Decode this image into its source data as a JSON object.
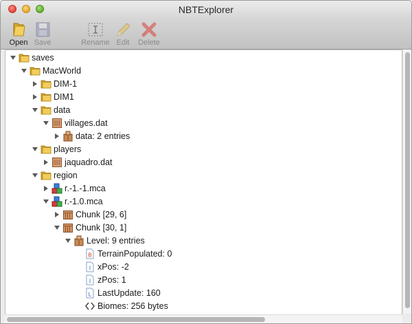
{
  "window": {
    "title": "NBTExplorer"
  },
  "toolbar": {
    "open_label": "Open",
    "save_label": "Save",
    "rename_label": "Rename",
    "edit_label": "Edit",
    "delete_label": "Delete"
  },
  "tree": {
    "rows": [
      {
        "label": "saves",
        "icon": "folder-icon",
        "expanded": true
      },
      {
        "label": "MacWorld",
        "icon": "folder-icon",
        "expanded": true
      },
      {
        "label": "DIM-1",
        "icon": "folder-icon",
        "expanded": false
      },
      {
        "label": "DIM1",
        "icon": "folder-icon",
        "expanded": false
      },
      {
        "label": "data",
        "icon": "folder-icon",
        "expanded": true
      },
      {
        "label": "villages.dat",
        "icon": "nbt-file-icon",
        "expanded": true
      },
      {
        "label": "data: 2 entries",
        "icon": "compound-tag-icon",
        "expanded": false
      },
      {
        "label": "players",
        "icon": "folder-icon",
        "expanded": true
      },
      {
        "label": "jaquadro.dat",
        "icon": "nbt-file-icon",
        "expanded": false
      },
      {
        "label": "region",
        "icon": "folder-icon",
        "expanded": true
      },
      {
        "label": "r.-1.-1.mca",
        "icon": "region-file-icon",
        "expanded": false
      },
      {
        "label": "r.-1.0.mca",
        "icon": "region-file-icon",
        "expanded": true
      },
      {
        "label": "Chunk [29, 6]",
        "icon": "chunk-icon",
        "expanded": false
      },
      {
        "label": "Chunk [30, 1]",
        "icon": "chunk-icon",
        "expanded": true
      },
      {
        "label": "Level: 9 entries",
        "icon": "compound-tag-icon",
        "expanded": true
      },
      {
        "label": "TerrainPopulated: 0",
        "icon": "byte-tag-icon",
        "letter": "B"
      },
      {
        "label": "xPos: -2",
        "icon": "int-tag-icon",
        "letter": "I"
      },
      {
        "label": "zPos: 1",
        "icon": "int-tag-icon",
        "letter": "I"
      },
      {
        "label": "LastUpdate: 160",
        "icon": "long-tag-icon",
        "letter": "L"
      },
      {
        "label": "Biomes: 256 bytes",
        "icon": "byte-array-tag-icon"
      }
    ]
  }
}
